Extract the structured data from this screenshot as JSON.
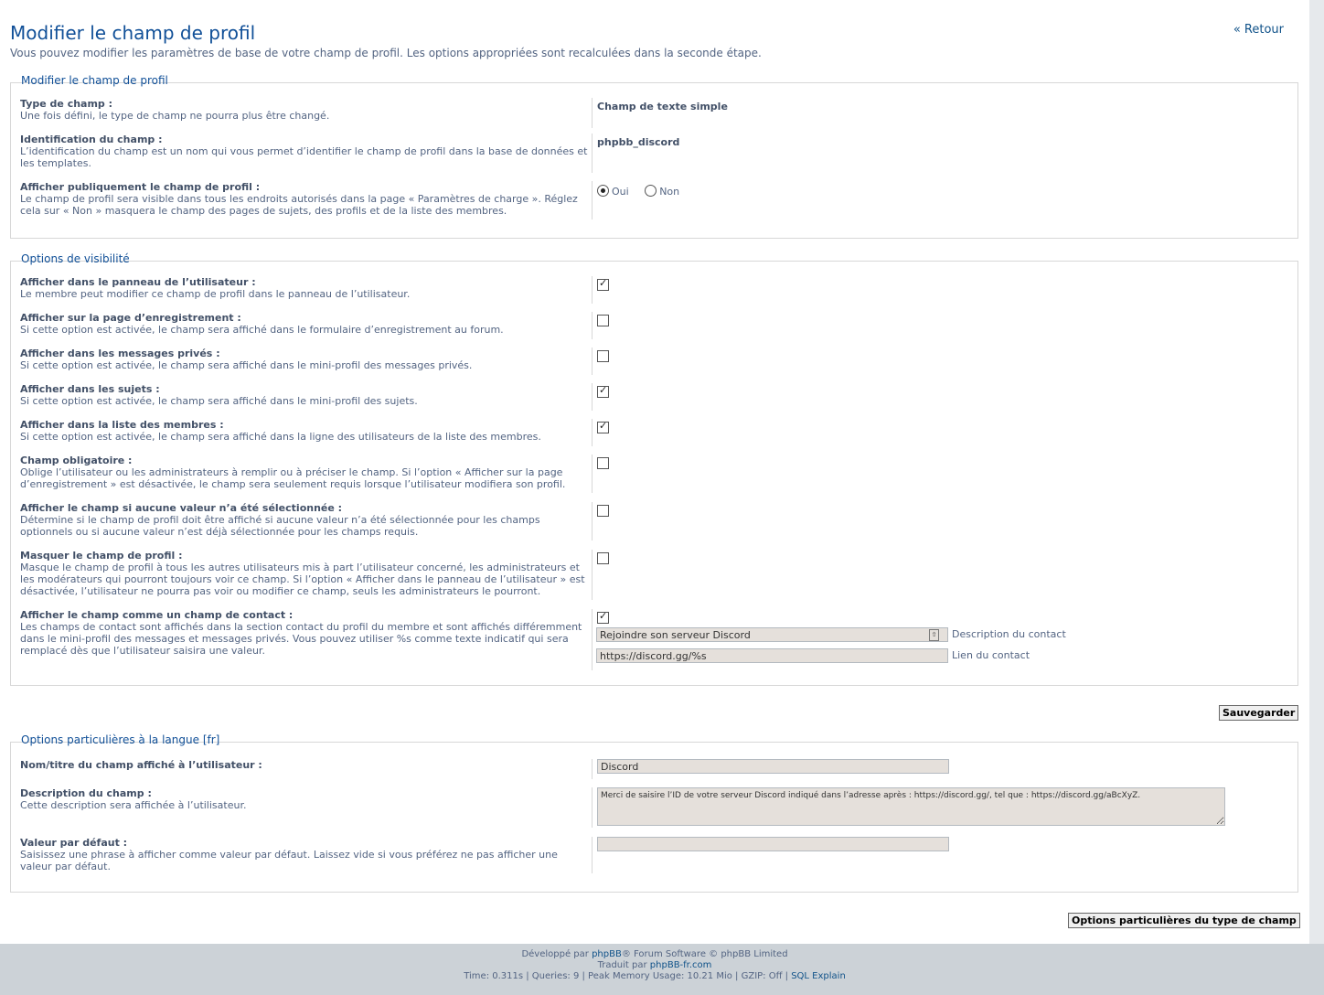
{
  "page": {
    "title": "Modifier le champ de profil",
    "intro": "Vous pouvez modifier les paramètres de base de votre champ de profil. Les options appropriées sont recalculées dans la seconde étape.",
    "back_link": "« Retour"
  },
  "section1": {
    "legend": "Modifier le champ de profil",
    "type_label": "Type de champ :",
    "type_desc": "Une fois défini, le type de champ ne pourra plus être changé.",
    "type_value": "Champ de texte simple",
    "ident_label": "Identification du champ :",
    "ident_desc": "L’identification du champ est un nom qui vous permet d’identifier le champ de profil dans la base de données et les templates.",
    "ident_value": "phpbb_discord",
    "public_label": "Afficher publiquement le champ de profil :",
    "public_desc": "Le champ de profil sera visible dans tous les endroits autorisés dans la page « Paramètres de charge ». Réglez cela sur « Non » masquera le champ des pages de sujets, des profils et de la liste des membres.",
    "yes": "Oui",
    "no": "Non",
    "public_selected": "Oui"
  },
  "section2": {
    "legend": "Options de visibilité",
    "options": [
      {
        "label": "Afficher dans le panneau de l’utilisateur :",
        "desc": "Le membre peut modifier ce champ de profil dans le panneau de l’utilisateur.",
        "checked": true
      },
      {
        "label": "Afficher sur la page d’enregistrement :",
        "desc": "Si cette option est activée, le champ sera affiché dans le formulaire d’enregistrement au forum.",
        "checked": false
      },
      {
        "label": "Afficher dans les messages privés :",
        "desc": "Si cette option est activée, le champ sera affiché dans le mini-profil des messages privés.",
        "checked": false
      },
      {
        "label": "Afficher dans les sujets :",
        "desc": "Si cette option est activée, le champ sera affiché dans le mini-profil des sujets.",
        "checked": true
      },
      {
        "label": "Afficher dans la liste des membres :",
        "desc": "Si cette option est activée, le champ sera affiché dans la ligne des utilisateurs de la liste des membres.",
        "checked": true
      },
      {
        "label": "Champ obligatoire :",
        "desc": "Oblige l’utilisateur ou les administrateurs à remplir ou à préciser le champ. Si l’option « Afficher sur la page d’enregistrement » est désactivée, le champ sera seulement requis lorsque l’utilisateur modifiera son profil.",
        "checked": false
      },
      {
        "label": "Afficher le champ si aucune valeur n’a été sélectionnée :",
        "desc": "Détermine si le champ de profil doit être affiché si aucune valeur n’a été sélectionnée pour les champs optionnels ou si aucune valeur n’est déjà sélectionnée pour les champs requis.",
        "checked": false
      },
      {
        "label": "Masquer le champ de profil :",
        "desc": "Masque le champ de profil à tous les autres utilisateurs mis à part l’utilisateur concerné, les administrateurs et les modérateurs qui pourront toujours voir ce champ. Si l’option « Afficher dans le panneau de l’utilisateur » est désactivée, l’utilisateur ne pourra pas voir ou modifier ce champ, seuls les administrateurs le pourront.",
        "checked": false
      },
      {
        "label": "Afficher le champ comme un champ de contact :",
        "desc": "Les champs de contact sont affichés dans la section contact du profil du membre et sont affichés différemment dans le mini-profil des messages et messages privés. Vous pouvez utiliser %s comme texte indicatif qui sera remplacé dès que l’utilisateur saisira une valeur.",
        "checked": true
      }
    ],
    "contact_desc_value": "Rejoindre son serveur Discord",
    "contact_desc_label": "Description du contact",
    "contact_url_value": "https://discord.gg/%s",
    "contact_url_label": "Lien du contact"
  },
  "save_button": "Sauvegarder",
  "section3": {
    "legend": "Options particulières à la langue [fr]",
    "name_label": "Nom/titre du champ affiché à l’utilisateur :",
    "name_value": "Discord",
    "fdesc_label": "Description du champ :",
    "fdesc_desc": "Cette description sera affichée à l’utilisateur.",
    "fdesc_value": "Merci de saisire l’ID de votre serveur Discord indiqué dans l’adresse après : https://discord.gg/, tel que : https://discord.gg/aBcXyZ.",
    "default_label": "Valeur par défaut :",
    "default_desc": "Saisissez une phrase à afficher comme valeur par défaut. Laissez vide si vous préférez ne pas afficher une valeur par défaut.",
    "default_value": ""
  },
  "type_options_button": "Options particulières du type de champ",
  "footer": {
    "line1_pre": "Développé par ",
    "line1_link": "phpBB",
    "line1_post": "® Forum Software © phpBB Limited",
    "line2_pre": "Traduit par ",
    "line2_link": "phpBB-fr.com",
    "line3_pre": "Time: 0.311s | Queries: 9 | Peak Memory Usage: 10.21 Mio | GZIP: Off | ",
    "line3_link": "SQL Explain"
  }
}
